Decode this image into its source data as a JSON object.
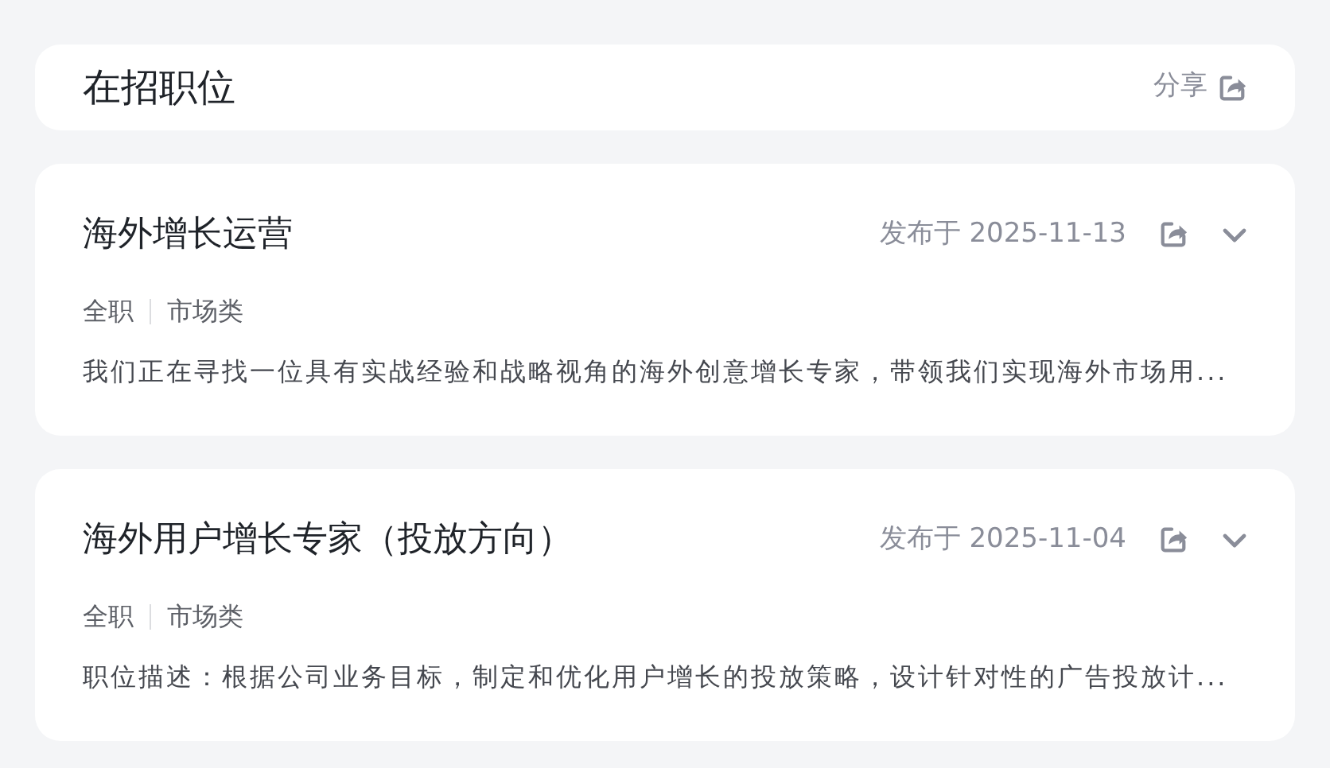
{
  "header": {
    "title": "在招职位",
    "share_label": "分享"
  },
  "jobs": [
    {
      "title": "海外增长运营",
      "date": "发布于 2025-11-13",
      "tags": [
        "全职",
        "市场类"
      ],
      "description": "我们正在寻找一位具有实战经验和战略视角的海外创意增长专家，带领我们实现海外市场用..."
    },
    {
      "title": "海外用户增长专家（投放方向）",
      "date": "发布于 2025-11-04",
      "tags": [
        "全职",
        "市场类"
      ],
      "description": "职位描述：根据公司业务目标，制定和优化用户增长的投放策略，设计针对性的广告投放计..."
    }
  ]
}
